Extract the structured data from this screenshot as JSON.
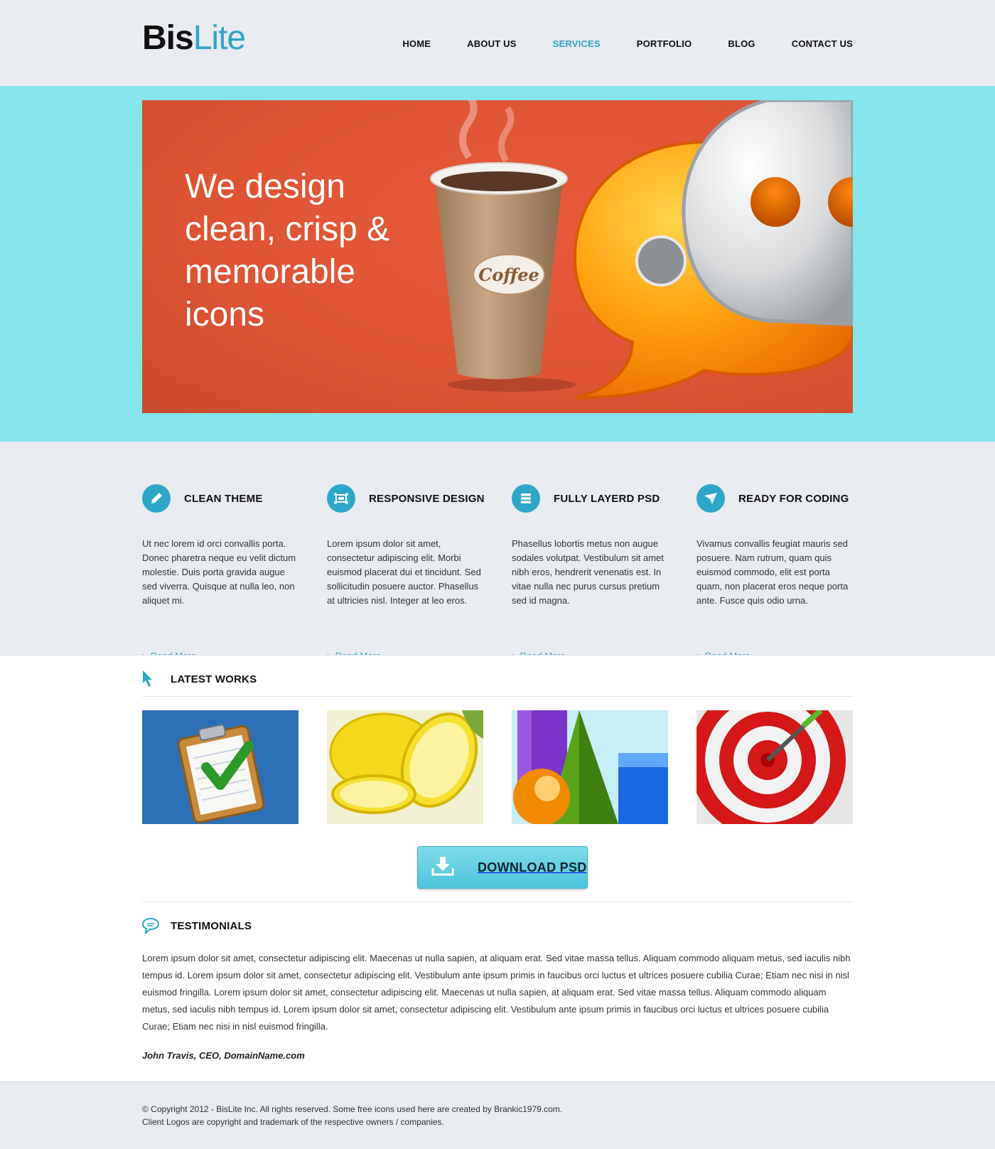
{
  "logo": {
    "bold": "Bis",
    "light": "Lite"
  },
  "nav": [
    "HOME",
    "ABOUT US",
    "SERVICES",
    "PORTFOLIO",
    "BLOG",
    "CONTACT US"
  ],
  "hero": {
    "lines": [
      "We design",
      "clean, crisp &",
      "memorable",
      "icons"
    ],
    "cup_label": "Coffee"
  },
  "features": [
    {
      "icon": "pencil-icon",
      "title": "CLEAN THEME",
      "text": "Ut nec lorem id orci convallis porta. Donec pharetra neque eu velit dictum molestie. Duis porta gravida augue sed viverra. Quisque at nulla leo, non aliquet mi.",
      "more": "Read More"
    },
    {
      "icon": "screen-icon",
      "title": "RESPONSIVE DESIGN",
      "text": "Lorem ipsum dolor sit amet, consectetur adipiscing elit. Morbi euismod placerat dui et tincidunt. Sed sollicitudin posuere auctor. Phasellus at ultricies nisl. Integer at leo eros.",
      "more": "Read More"
    },
    {
      "icon": "layers-icon",
      "title": "FULLY LAYERD PSD",
      "text": " Phasellus lobortis metus non augue sodales volutpat. Vestibulum sit amet nibh eros, hendrerit venenatis est. In vitae nulla nec purus cursus pretium sed id magna.",
      "more": "Read More"
    },
    {
      "icon": "paper-plane-icon",
      "title": "READY FOR CODING",
      "text": "Vivamus convallis feugiat mauris sed posuere. Nam rutrum, quam quis euismod commodo, elit est porta quam, non placerat eros neque porta ante. Fusce quis odio urna.",
      "more": "Read More"
    }
  ],
  "latest_works": {
    "title": "LATEST WORKS",
    "items": [
      "clipboard-checkmark-image",
      "lemons-image",
      "3d-shapes-image",
      "target-dart-image"
    ]
  },
  "download": {
    "label": "DOWNLOAD PSD"
  },
  "testimonials": {
    "title": "TESTIMONIALS",
    "text": "Lorem ipsum dolor sit amet, consectetur adipiscing elit. Maecenas ut nulla sapien, at aliquam erat. Sed vitae massa tellus. Aliquam commodo aliquam metus, sed iaculis nibh tempus id. Lorem ipsum dolor sit amet, consectetur adipiscing elit. Vestibulum ante ipsum primis in faucibus orci luctus et ultrices posuere cubilia Curae; Etiam nec nisi in nisl euismod fringilla. Lorem ipsum dolor sit amet, consectetur adipiscing elit. Maecenas ut nulla sapien, at aliquam erat. Sed vitae massa tellus. Aliquam commodo aliquam metus, sed iaculis nibh tempus id. Lorem ipsum dolor sit amet, consectetur adipiscing elit. Vestibulum ante ipsum primis in faucibus orci luctus et ultrices posuere cubilia Curae; Etiam nec nisi in nisl euismod fringilla.",
    "author": "John Travis, CEO, DomainName.com"
  },
  "footer": {
    "line1": "© Copyright 2012 - BisLite Inc. All rights reserved. Some free icons used here are created by Brankic1979.com.",
    "line2": "Client Logos are copyright and trademark of the respective owners / companies."
  },
  "colors": {
    "accent": "#2ea6c9",
    "hero_band": "#85e4ec",
    "hero_bg": "#dd5434",
    "page_bg": "#e8ebf0"
  }
}
